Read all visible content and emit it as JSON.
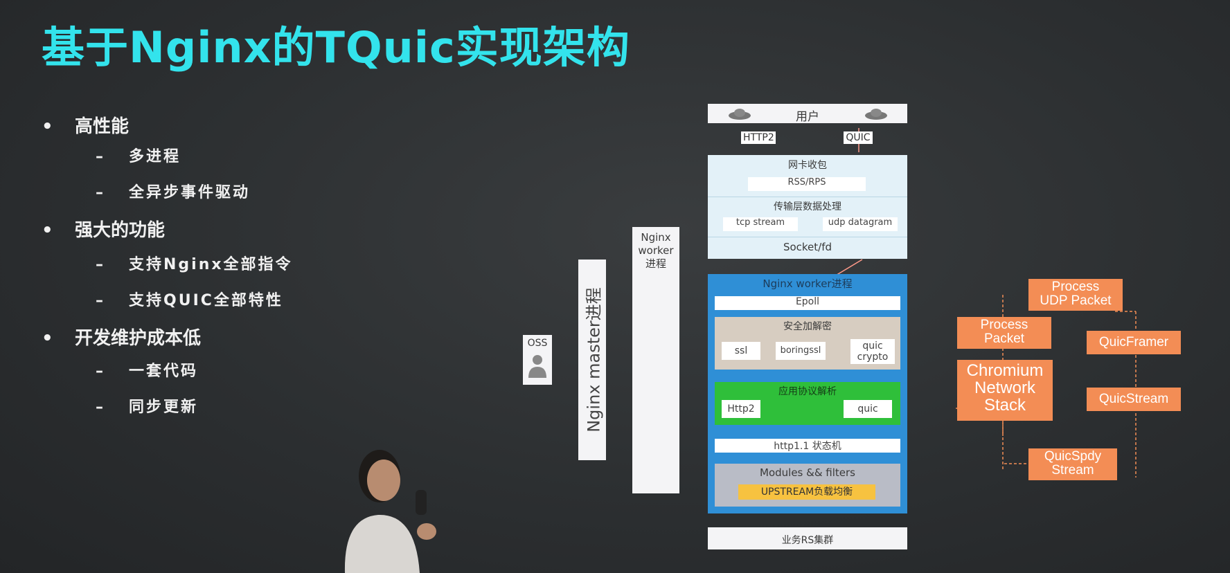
{
  "title": "基于Nginx的TQuic实现架构",
  "bullets": [
    {
      "level": 1,
      "mark": "•",
      "text": "高性能"
    },
    {
      "level": 2,
      "mark": "–",
      "text": "多进程"
    },
    {
      "level": 2,
      "mark": "–",
      "text": "全异步事件驱动"
    },
    {
      "level": 1,
      "mark": "•",
      "text": "强大的功能"
    },
    {
      "level": 2,
      "mark": "–",
      "text": "支持Nginx全部指令"
    },
    {
      "level": 2,
      "mark": "–",
      "text": "支持QUIC全部特性"
    },
    {
      "level": 1,
      "mark": "•",
      "text": "开发维护成本低"
    },
    {
      "level": 2,
      "mark": "–",
      "text": "一套代码"
    },
    {
      "level": 2,
      "mark": "–",
      "text": "同步更新"
    }
  ],
  "diagram": {
    "oss": "OSS",
    "master": "Nginx master进程",
    "worker_side": "Nginx\nworker\n进程",
    "user": "用户",
    "http2_tag": "HTTP2",
    "quic_tag": "QUIC",
    "nic_title": "网卡收包",
    "rss": "RSS/RPS",
    "transport_title": "传输层数据处理",
    "tcp_stream": "tcp stream",
    "udp_datagram": "udp datagram",
    "socket": "Socket/fd",
    "worker_title": "Nginx worker进程",
    "epoll": "Epoll",
    "crypto_title": "安全加解密",
    "ssl": "ssl",
    "boringssl": "boringssl",
    "quic_crypto": "quic\ncrypto",
    "app_title": "应用协议解析",
    "http2": "Http2",
    "quic": "quic",
    "state_machine": "http1.1 状态机",
    "modules": "Modules && filters",
    "upstream": "UPSTREAM负载均衡",
    "backend": "业务RS集群",
    "chromium": "Chromium\nNetwork\nStack",
    "process_packet": "Process\nPacket",
    "process_udp": "Process\nUDP Packet",
    "quic_framer": "QuicFramer",
    "quic_stream": "QuicStream",
    "quic_spdy": "QuicSpdy\nStream"
  },
  "colors": {
    "title": "#33e3ec",
    "orange": "#f38d55",
    "blue_panel": "#2f8fd6",
    "green_panel": "#2fbf3a",
    "upstream": "#f7c240"
  }
}
